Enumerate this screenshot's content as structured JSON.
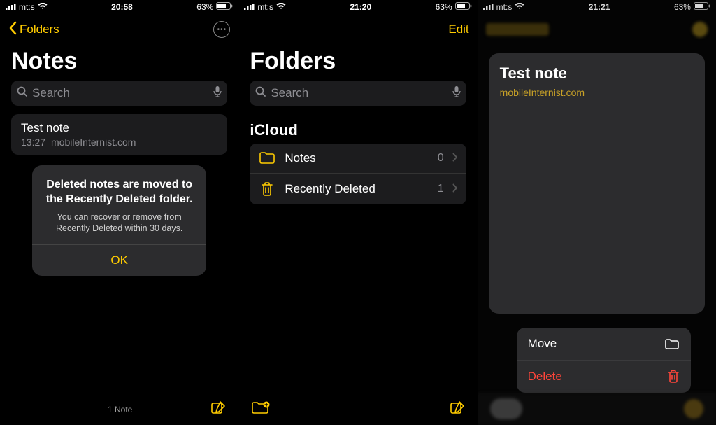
{
  "status": {
    "carrier": "mt:s",
    "battery": "63%"
  },
  "accent": "#FFCC00",
  "screen1": {
    "time": "20:58",
    "back_label": "Folders",
    "title": "Notes",
    "search_placeholder": "Search",
    "note": {
      "title": "Test note",
      "time": "13:27",
      "preview": "mobileInternist.com"
    },
    "modal": {
      "title": "Deleted notes are moved to the Recently Deleted folder.",
      "subtitle": "You can recover or remove from Recently Deleted within 30 days.",
      "ok": "OK"
    },
    "footer_count": "1 Note"
  },
  "screen2": {
    "time": "21:20",
    "edit_label": "Edit",
    "title": "Folders",
    "search_placeholder": "Search",
    "section": "iCloud",
    "folders": [
      {
        "name": "Notes",
        "count": "0",
        "icon": "folder"
      },
      {
        "name": "Recently Deleted",
        "count": "1",
        "icon": "trash"
      }
    ]
  },
  "screen3": {
    "time": "21:21",
    "preview": {
      "title": "Test note",
      "link": "mobileInternist.com"
    },
    "actions": {
      "move": "Move",
      "delete": "Delete"
    }
  }
}
